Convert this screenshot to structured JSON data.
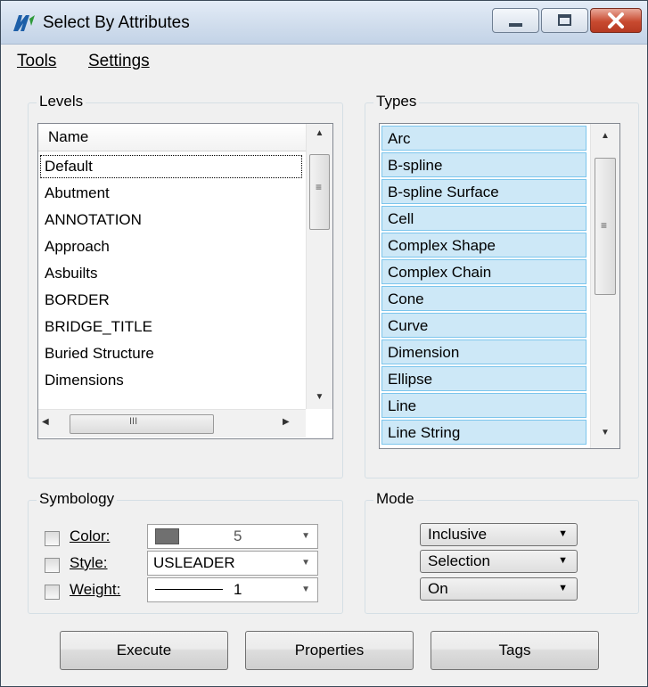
{
  "window": {
    "title": "Select By Attributes"
  },
  "menu": {
    "tools": "Tools",
    "settings": "Settings"
  },
  "levels": {
    "group_label": "Levels",
    "column_header": "Name",
    "items": [
      "Default",
      "Abutment",
      "ANNOTATION",
      "Approach",
      "Asbuilts",
      "BORDER",
      "BRIDGE_TITLE",
      "Buried Structure",
      "Dimensions"
    ],
    "hscroll_grip": "III"
  },
  "types": {
    "group_label": "Types",
    "items": [
      "Arc",
      "B-spline",
      "B-spline Surface",
      "Cell",
      "Complex Shape",
      "Complex Chain",
      "Cone",
      "Curve",
      "Dimension",
      "Ellipse",
      "Line",
      "Line String"
    ]
  },
  "symbology": {
    "group_label": "Symbology",
    "color_label": "Color:",
    "color_value": "5",
    "color_swatch": "#707070",
    "style_label": "Style:",
    "style_value": "USLEADER",
    "weight_label": "Weight:",
    "weight_value": "1"
  },
  "mode": {
    "group_label": "Mode",
    "operator": "Inclusive",
    "source": "Selection",
    "state": "On"
  },
  "buttons": {
    "execute": "Execute",
    "properties": "Properties",
    "tags": "Tags"
  }
}
